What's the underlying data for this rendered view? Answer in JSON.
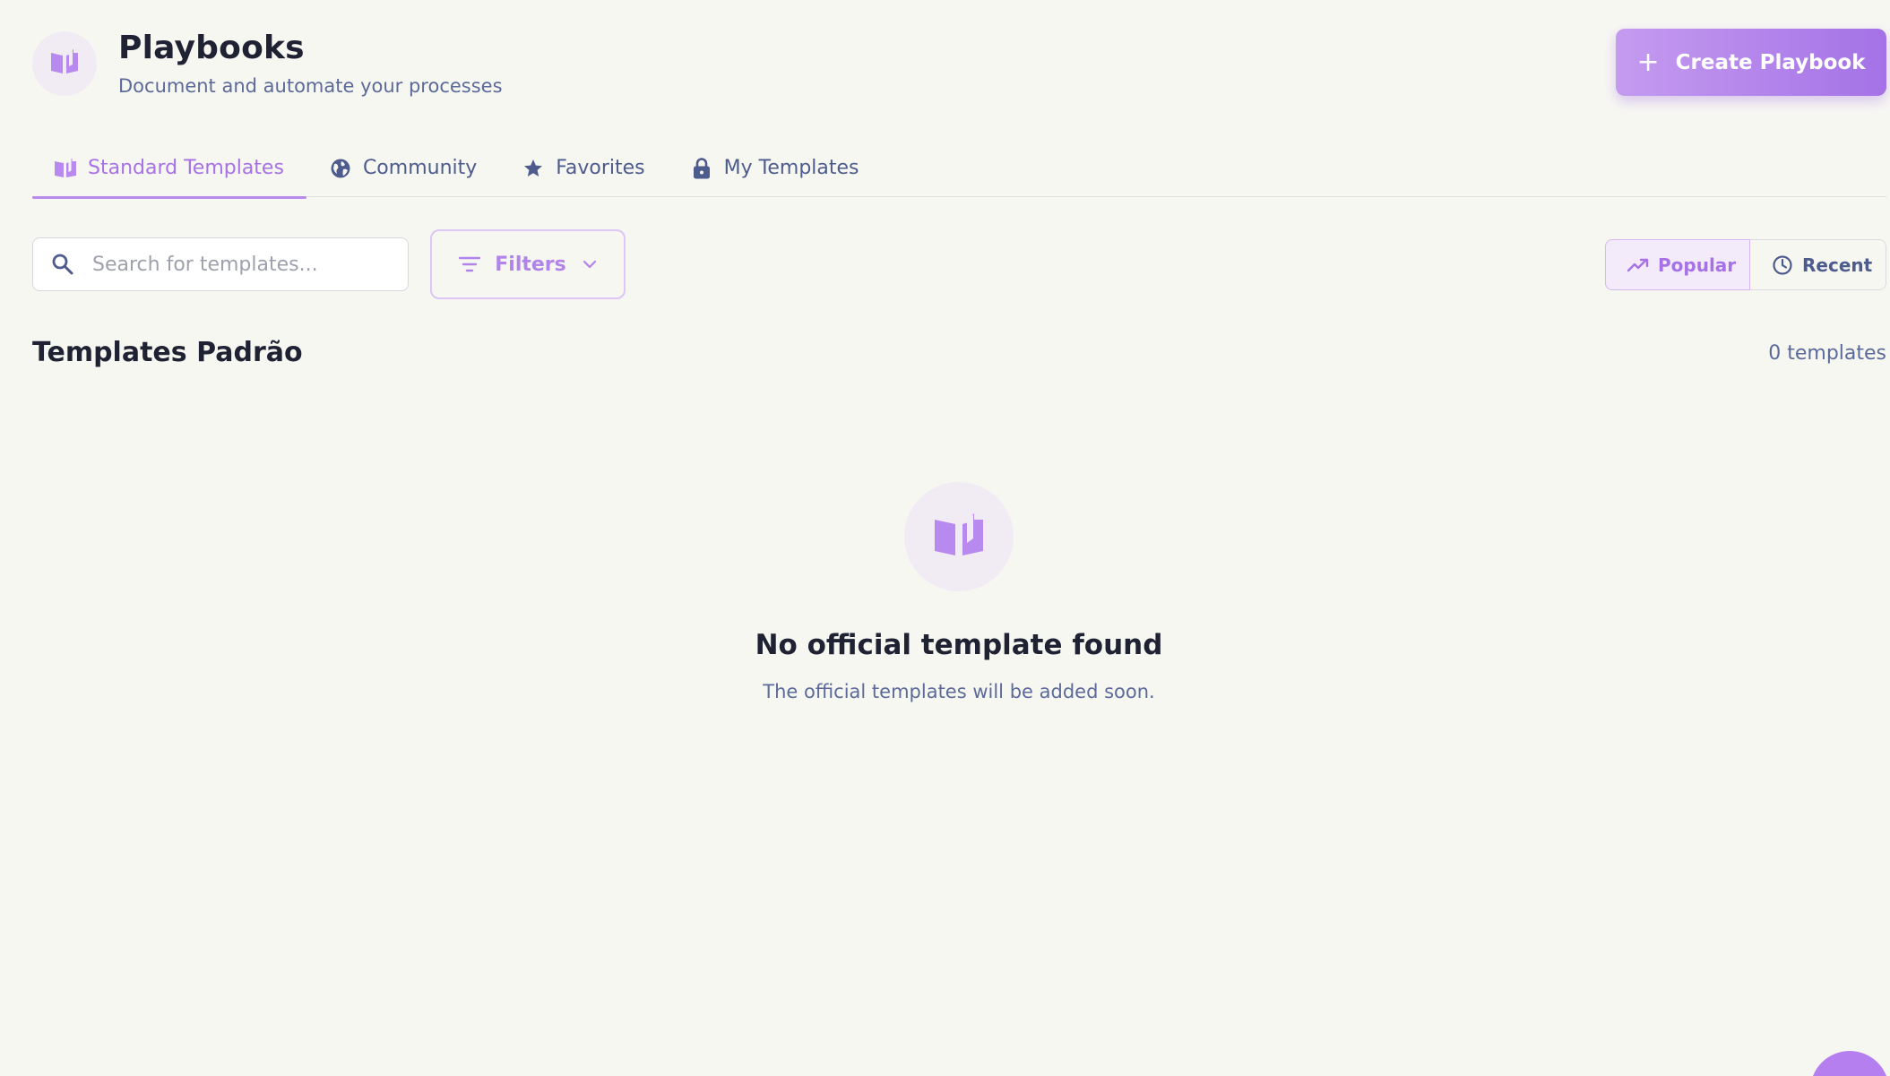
{
  "header": {
    "title": "Playbooks",
    "subtitle": "Document and automate your processes",
    "icon": "book-open-icon",
    "create_label": "Create Playbook"
  },
  "tabs": [
    {
      "label": "Standard Templates",
      "icon": "book-open-icon",
      "active": true
    },
    {
      "label": "Community",
      "icon": "globe-icon",
      "active": false
    },
    {
      "label": "Favorites",
      "icon": "star-icon",
      "active": false
    },
    {
      "label": "My Templates",
      "icon": "lock-icon",
      "active": false
    }
  ],
  "toolbar": {
    "search_placeholder": "Search for templates...",
    "filters_label": "Filters",
    "sort_popular": "Popular",
    "sort_recent": "Recent",
    "active_sort": "Popular"
  },
  "section": {
    "title": "Templates Padrão",
    "count": "0 templates"
  },
  "empty_state": {
    "title": "No official template found",
    "subtitle": "The official templates will be added soon."
  },
  "colors": {
    "accent": "#a772e6",
    "accent_light": "#c59bf0",
    "background": "#f7f7f2",
    "text_muted": "#5b6a9a"
  }
}
